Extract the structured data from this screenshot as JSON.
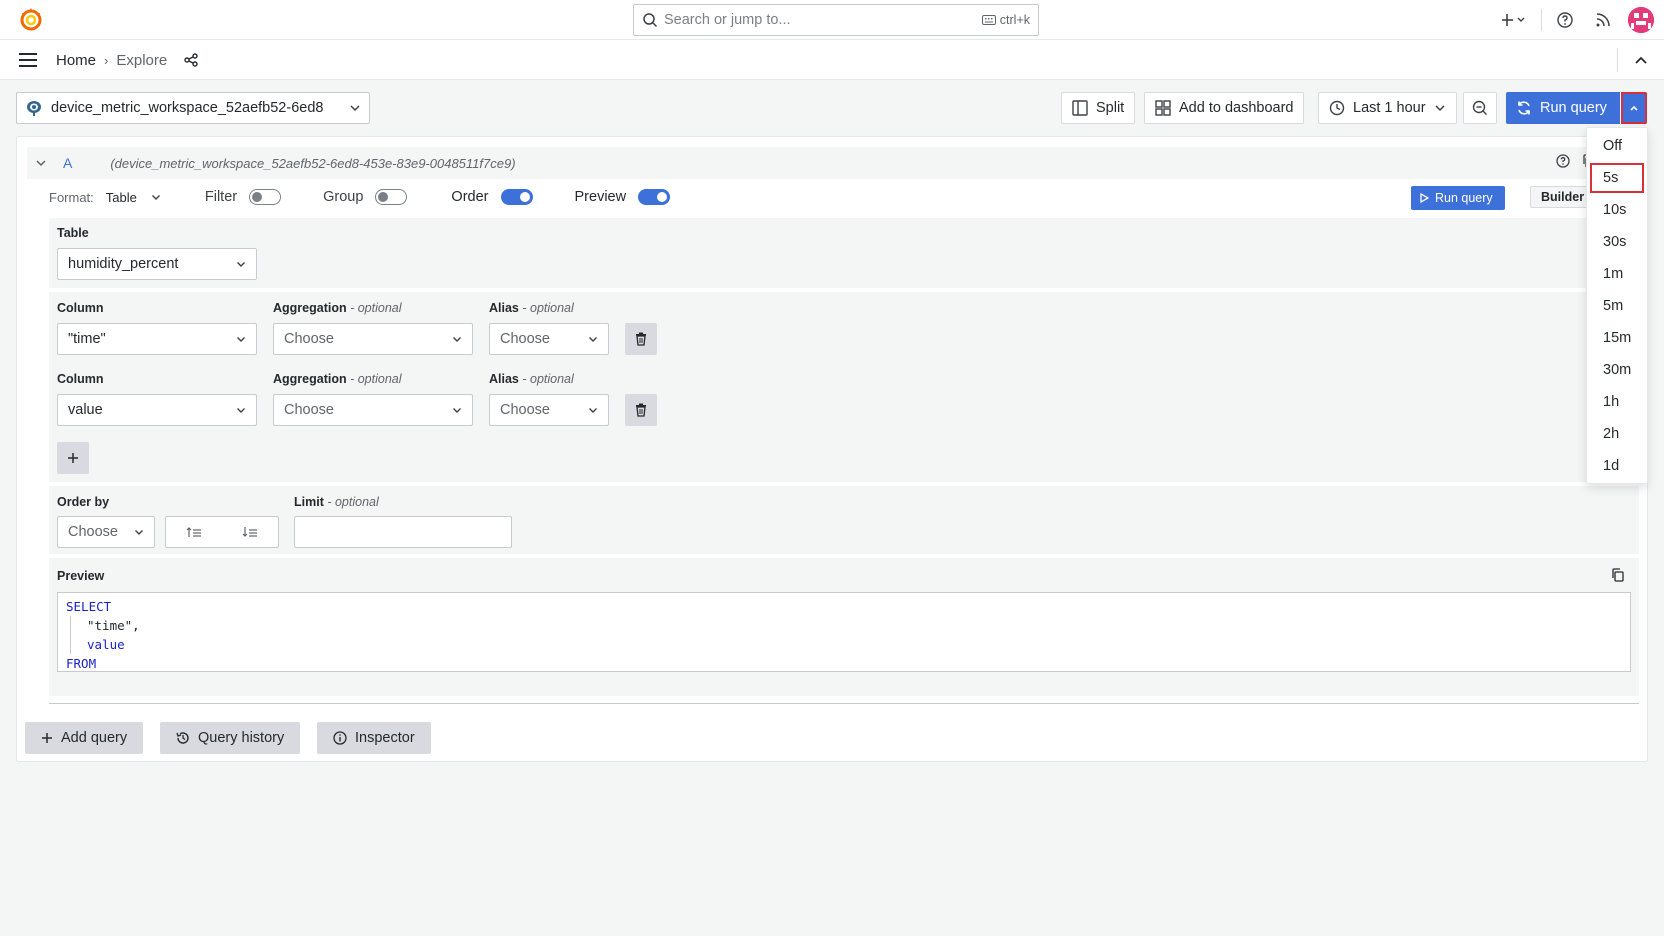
{
  "colors": {
    "accent": "#3d71d9",
    "highlight": "#d6303a",
    "brand_logo": "#f46800"
  },
  "search": {
    "placeholder": "Search or jump to...",
    "shortcut": "ctrl+k"
  },
  "breadcrumb": {
    "home": "Home",
    "separator": "›",
    "current": "Explore"
  },
  "toolbar": {
    "datasource": "device_metric_workspace_52aefb52-6ed8",
    "split": "Split",
    "add_to_dashboard": "Add to dashboard",
    "time_range": "Last 1 hour",
    "run_query": "Run query"
  },
  "query": {
    "ref_id": "A",
    "datasource_full": "(device_metric_workspace_52aefb52-6ed8-453e-83e9-0048511f7ce9)",
    "format_label": "Format:",
    "format_value": "Table",
    "toggles": {
      "filter": {
        "label": "Filter",
        "on": false
      },
      "group": {
        "label": "Group",
        "on": false
      },
      "order": {
        "label": "Order",
        "on": true
      },
      "preview": {
        "label": "Preview",
        "on": true
      }
    },
    "run_query": "Run query",
    "builder": "Builder",
    "table_label": "Table",
    "table_value": "humidity_percent",
    "columns": [
      {
        "column_label": "Column",
        "column": "\"time\"",
        "aggregation_label": "Aggregation",
        "aggregation_optional": " - optional",
        "aggregation": "Choose",
        "alias_label": "Alias",
        "alias_optional": " - optional",
        "alias": "Choose"
      },
      {
        "column_label": "Column",
        "column": "value",
        "aggregation_label": "Aggregation",
        "aggregation_optional": " - optional",
        "aggregation": "Choose",
        "alias_label": "Alias",
        "alias_optional": " - optional",
        "alias": "Choose"
      }
    ],
    "order_by_label": "Order by",
    "order_by_value": "Choose",
    "limit_label": "Limit",
    "limit_optional": " - optional",
    "limit_value": "",
    "preview_label": "Preview",
    "sql": {
      "select": "SELECT",
      "col1": "\"time\",",
      "col2": "value",
      "from": "FROM"
    }
  },
  "bottom": {
    "add_query": "Add query",
    "query_history": "Query history",
    "inspector": "Inspector"
  },
  "refresh_options": [
    "Off",
    "5s",
    "10s",
    "30s",
    "1m",
    "5m",
    "15m",
    "30m",
    "1h",
    "2h",
    "1d"
  ],
  "refresh_selected": "5s"
}
